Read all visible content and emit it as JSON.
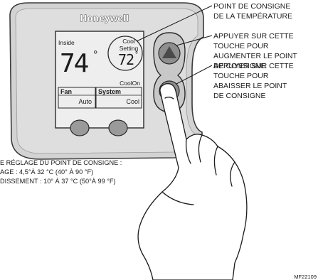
{
  "thermostat": {
    "brand": "Honeywell",
    "inside_label": "Inside",
    "inside_temp": "74",
    "degree_symbol": "°",
    "setpoint_label_line1": "Cool",
    "setpoint_label_line2": "Setting",
    "setpoint_temp": "72",
    "status_text": "CoolOn",
    "fan_label": "Fan",
    "fan_value": "Auto",
    "system_label": "System",
    "system_value": "Cool"
  },
  "callouts": {
    "setpoint": [
      "POINT DE CONSIGNE",
      "DE LA TEMPÉRATURE"
    ],
    "up_button": [
      "APPUYER SUR CETTE",
      "TOUCHE POUR",
      "AUGMENTER LE POINT",
      "DE CONSIGNE"
    ],
    "down_button": [
      "APPUYER SUR CETTE",
      "TOUCHE POUR",
      "ABAISSER LE POINT",
      "DE CONSIGNE"
    ]
  },
  "range_info": [
    "E RÉGLAGE DU POINT DE CONSIGNE :",
    "AGE : 4,5°À 32 °C (40° À 90 °F)",
    "DISSEMENT : 10° À 37 °C (50°À 99 °F)"
  ],
  "figure_id": "MF22109"
}
